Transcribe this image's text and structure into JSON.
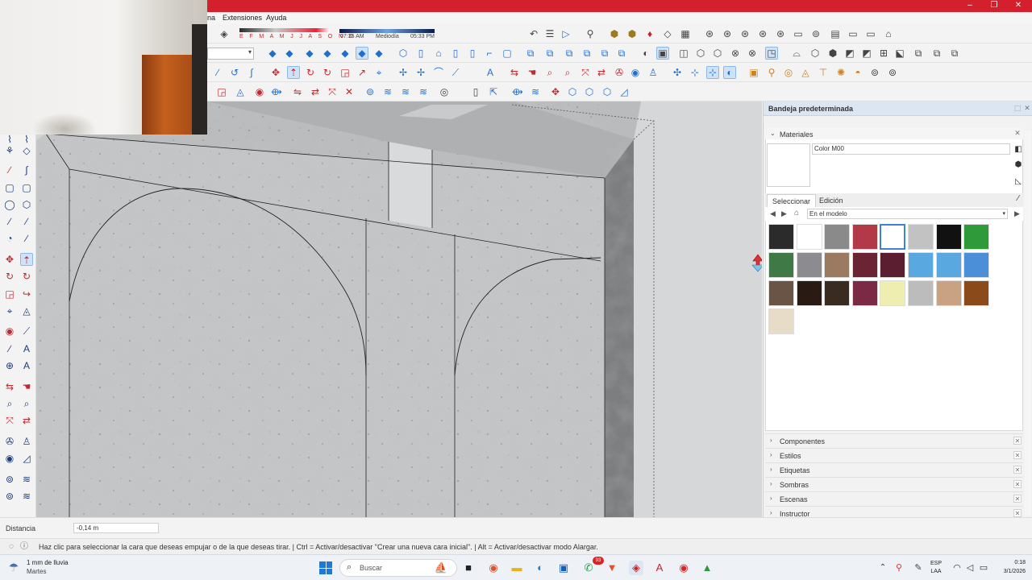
{
  "menubar": {
    "items": [
      "na",
      "Extensiones",
      "Ayuda"
    ]
  },
  "shadows": {
    "months": "E F M A M J J A S O N D",
    "time_start": "07:35 AM",
    "time_mid": "Mediodía",
    "time_end": "05:33 PM"
  },
  "tray": {
    "title": "Bandeja predeterminada",
    "materials_title": "Materiales",
    "material_name": "Color M00",
    "tab_select": "Seleccionar",
    "tab_edit": "Edición",
    "collection": "En el modelo",
    "swatches": [
      "#2b2b2b",
      "#ffffff",
      "#8a8a8a",
      "#b23a48",
      "#ffffff",
      "#c2c2c2",
      "#111111",
      "#2f9a3a",
      "#3f7a46",
      "#8c8c90",
      "#9a7a60",
      "#6b2433",
      "#5a1e30",
      "#5aa8e0",
      "#5aa8e0",
      "#4a8fd8",
      "#6a5446",
      "#2a1a14",
      "#3a2b20",
      "#7a2a44",
      "#eeeeb0",
      "#bcbcbc",
      "#c8a282",
      "#8a4a1a",
      "#e6dcc8"
    ],
    "sections": [
      "Componentes",
      "Estilos",
      "Etiquetas",
      "Sombras",
      "Escenas",
      "Instructor"
    ]
  },
  "measurement": {
    "label": "Distancia",
    "value": "-0,14 m"
  },
  "status": {
    "text": "Haz clic para seleccionar la cara que deseas empujar o de la que deseas tirar. | Ctrl = Activar/desactivar \"Crear una nueva cara inicial\". | Alt = Activar/desactivar modo Alargar."
  },
  "taskbar": {
    "weather": "1 mm de lluvia",
    "weather_day": "Martes",
    "search_placeholder": "Buscar",
    "badge": "93",
    "lang1": "ESP",
    "lang2": "LAA",
    "time": "0:18",
    "date": "3/1/2026"
  }
}
